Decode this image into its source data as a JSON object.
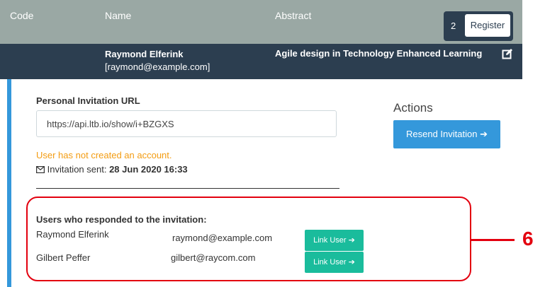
{
  "header": {
    "col_code": "Code",
    "col_name": "Name",
    "col_abstract": "Abstract",
    "register_count": "2",
    "register_label": "Register"
  },
  "row": {
    "name": "Raymond Elferink",
    "email": "[raymond@example.com]",
    "abstract": "Agile design in Technology Enhanced Learning",
    "edit_icon": "edit-icon"
  },
  "detail": {
    "url_label": "Personal Invitation URL",
    "url_value": "https://api.ltb.io/show/i+BZGXS",
    "actions_title": "Actions",
    "resend_label": "Resend Invitation",
    "arrow": "➔",
    "warning": "User has not created an account.",
    "sent_label": "Invitation sent:",
    "sent_date": "28 Jun 2020 16:33",
    "envelope_icon": "envelope-icon"
  },
  "responded": {
    "title": "Users who responded to the invitation:",
    "users": [
      {
        "name": "Raymond Elferink",
        "email": "raymond@example.com",
        "button": "Link User"
      },
      {
        "name": "Gilbert Peffer",
        "email": "gilbert@raycom.com",
        "button": "Link User"
      }
    ]
  },
  "callout": {
    "number": "6",
    "color": "#e3000f"
  },
  "colors": {
    "header_bg": "#9aa8a4",
    "row_bg": "#2c3e50",
    "accent": "#3498db",
    "link_btn": "#1abc9c",
    "warning": "#f39c12"
  }
}
